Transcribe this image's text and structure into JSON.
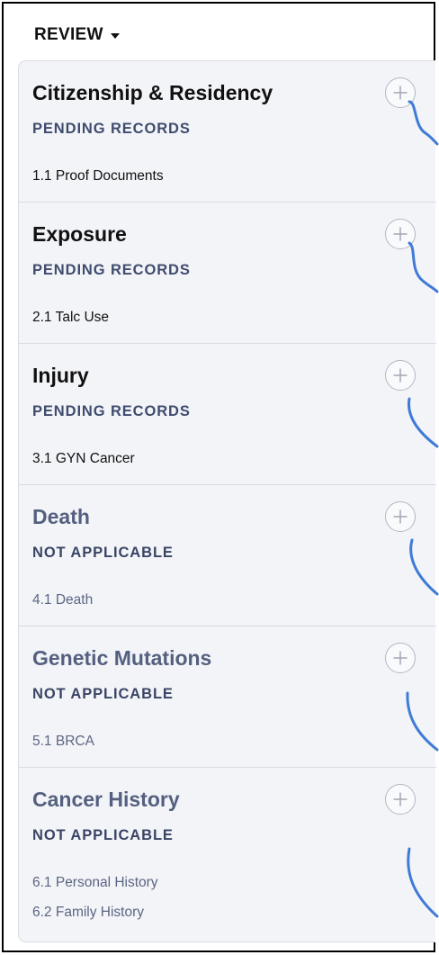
{
  "review": {
    "label": "REVIEW",
    "caret_icon": "caret-down-icon"
  },
  "sections": [
    {
      "id": "citizenship-residency",
      "title": "Citizenship & Residency",
      "status": "PENDING RECORDS",
      "applicable": true,
      "items": [
        {
          "label": "1.1 Proof Documents"
        }
      ]
    },
    {
      "id": "exposure",
      "title": "Exposure",
      "status": "PENDING RECORDS",
      "applicable": true,
      "items": [
        {
          "label": "2.1 Talc Use"
        }
      ]
    },
    {
      "id": "injury",
      "title": "Injury",
      "status": "PENDING RECORDS",
      "applicable": true,
      "items": [
        {
          "label": "3.1 GYN Cancer"
        }
      ]
    },
    {
      "id": "death",
      "title": "Death",
      "status": "NOT APPLICABLE",
      "applicable": false,
      "items": [
        {
          "label": "4.1 Death"
        }
      ]
    },
    {
      "id": "genetic-mutations",
      "title": "Genetic Mutations",
      "status": "NOT APPLICABLE",
      "applicable": false,
      "items": [
        {
          "label": "5.1 BRCA"
        }
      ]
    },
    {
      "id": "cancer-history",
      "title": "Cancer History",
      "status": "NOT APPLICABLE",
      "applicable": false,
      "items": [
        {
          "label": "6.1 Personal History"
        },
        {
          "label": "6.2 Family History"
        }
      ]
    }
  ],
  "icons": {
    "add": "plus-circle-icon",
    "connector": "curved-connector-line"
  },
  "colors": {
    "panel_background": "#f3f4f8",
    "pending_status": "#3f4c6e",
    "not_applicable_text": "#54607f",
    "connector_line": "#3f7bd6",
    "add_button_border": "#b3b7c2"
  }
}
